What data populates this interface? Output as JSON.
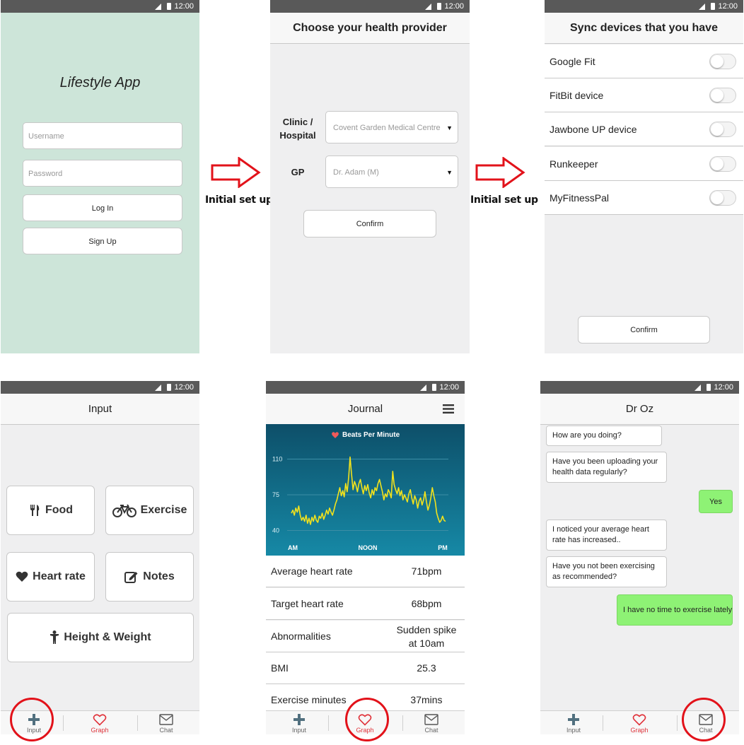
{
  "status_bar": {
    "time": "12:00"
  },
  "login": {
    "title": "Lifestyle App",
    "username_placeholder": "Username",
    "password_placeholder": "Password",
    "login_label": "Log In",
    "signup_label": "Sign Up",
    "bg_color": "#cde5d9"
  },
  "flow": {
    "arrow_label_1": "Initial set up",
    "arrow_label_2": "Initial set up",
    "arrow_color": "#e2121a"
  },
  "provider": {
    "title": "Choose your health provider",
    "clinic_label": "Clinic /\nHospital",
    "clinic_value": "Covent Garden Medical Centre",
    "gp_label": "GP",
    "gp_value": "Dr. Adam (M)",
    "confirm_label": "Confirm"
  },
  "sync": {
    "title": "Sync devices that you have",
    "devices": [
      {
        "name": "Google Fit",
        "enabled": false
      },
      {
        "name": "FitBit device",
        "enabled": false
      },
      {
        "name": "Jawbone UP device",
        "enabled": false
      },
      {
        "name": "Runkeeper",
        "enabled": false
      },
      {
        "name": "MyFitnessPal",
        "enabled": false
      }
    ],
    "confirm_label": "Confirm"
  },
  "input": {
    "title": "Input",
    "tiles": {
      "food": {
        "label": "Food",
        "icon": "fork-knife-icon"
      },
      "exercise": {
        "label": "Exercise",
        "icon": "bicycle-icon"
      },
      "heart": {
        "label": "Heart rate",
        "icon": "heart-icon"
      },
      "notes": {
        "label": "Notes",
        "icon": "pencil-icon"
      },
      "height": {
        "label": "Height & Weight",
        "icon": "person-icon"
      }
    }
  },
  "journal": {
    "title": "Journal",
    "menu_icon": "hamburger-icon",
    "stats": [
      {
        "label": "Average heart rate",
        "value": "71bpm"
      },
      {
        "label": "Target heart rate",
        "value": "68bpm"
      },
      {
        "label": "Abnormalities",
        "value": "Sudden spike at 10am"
      },
      {
        "label": "BMI",
        "value": "25.3"
      },
      {
        "label": "Exercise minutes",
        "value": "37mins"
      }
    ]
  },
  "chart_data": {
    "type": "line",
    "title": "Beats Per Minute",
    "xlabel": "",
    "ylabel": "",
    "x_ticks": [
      "AM",
      "NOON",
      "PM"
    ],
    "y_ticks": [
      40,
      75,
      110
    ],
    "ylim": [
      30,
      120
    ],
    "grid": true,
    "line_color": "#f2e21c",
    "background_color": "#0d4f69",
    "series": [
      {
        "name": "",
        "values": [
          57,
          60,
          55,
          62,
          58,
          64,
          55,
          50,
          53,
          49,
          55,
          47,
          52,
          46,
          53,
          49,
          55,
          50,
          48,
          54,
          52,
          57,
          51,
          55,
          60,
          56,
          62,
          58,
          55,
          60,
          66,
          70,
          76,
          82,
          74,
          79,
          73,
          86,
          78,
          92,
          112,
          95,
          80,
          88,
          84,
          78,
          86,
          90,
          82,
          76,
          84,
          79,
          85,
          77,
          72,
          80,
          75,
          82,
          79,
          86,
          90,
          84,
          78,
          70,
          76,
          73,
          80,
          77,
          72,
          98,
          85,
          80,
          76,
          82,
          74,
          79,
          70,
          75,
          72,
          68,
          76,
          80,
          72,
          66,
          74,
          70,
          62,
          69,
          72,
          65,
          70,
          78,
          68,
          60,
          65,
          72,
          82,
          74,
          68,
          57,
          52,
          48,
          50,
          54,
          50,
          49
        ]
      }
    ]
  },
  "chat": {
    "title": "Dr Oz",
    "messages": [
      {
        "text": "How are you doing?",
        "from": "doctor"
      },
      {
        "text": "Have you been uploading your health data regularly?",
        "from": "doctor"
      },
      {
        "text": "Yes",
        "from": "user"
      },
      {
        "text": "I noticed your average heart rate has increased..",
        "from": "doctor"
      },
      {
        "text": "Have you not been exercising as recommended?",
        "from": "doctor"
      },
      {
        "text": "I have no time to exercise lately..",
        "from": "user"
      }
    ]
  },
  "nav": {
    "input": "Input",
    "graph": "Graph",
    "chat": "Chat",
    "graph_color": "#e0333b",
    "highlight_color": "#e2121a"
  }
}
